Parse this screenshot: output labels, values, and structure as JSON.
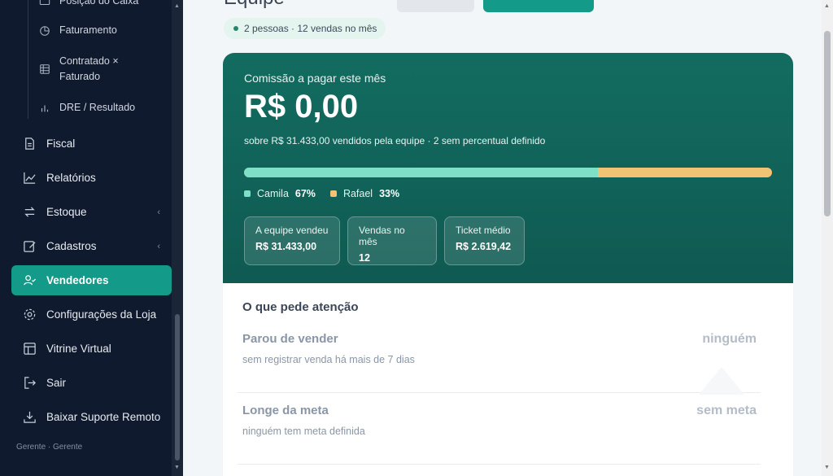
{
  "sidebar": {
    "sub_items": [
      {
        "label": "Posição do Caixa",
        "icon": "cash-icon"
      },
      {
        "label": "Faturamento",
        "icon": "pie-chart-icon"
      },
      {
        "label": "Contratado × Faturado",
        "icon": "table-icon"
      },
      {
        "label": "DRE / Resultado",
        "icon": "bar-chart-icon"
      }
    ],
    "items": [
      {
        "label": "Fiscal",
        "icon": "document-icon"
      },
      {
        "label": "Relatórios",
        "icon": "line-chart-icon"
      },
      {
        "label": "Estoque",
        "icon": "swap-icon",
        "chevron": "‹"
      },
      {
        "label": "Cadastros",
        "icon": "edit-icon",
        "chevron": "‹"
      },
      {
        "label": "Vendedores",
        "icon": "user-check-icon",
        "active": true
      },
      {
        "label": "Configurações da Loja",
        "icon": "gear-icon"
      },
      {
        "label": "Vitrine Virtual",
        "icon": "layout-icon"
      },
      {
        "label": "Sair",
        "icon": "logout-icon"
      },
      {
        "label": "Baixar Suporte Remoto",
        "icon": "download-icon"
      }
    ],
    "footer_role": "Gerente · Gerente"
  },
  "main": {
    "page_title": "Equipe",
    "summary_pill": "2 pessoas · 12 vendas no mês",
    "commission": {
      "label": "Comissão a pagar este mês",
      "amount": "R$ 0,00",
      "subtitle": "sobre R$ 31.433,00 vendidos pela equipe · 2 sem percentual definido",
      "split": [
        {
          "name": "Camila",
          "pct_label": "67%",
          "share": 0.67,
          "color": "#7fe0c8"
        },
        {
          "name": "Rafael",
          "pct_label": "33%",
          "share": 0.33,
          "color": "#f2c275"
        }
      ],
      "stats": [
        {
          "label": "A equipe vendeu",
          "value": "R$ 31.433,00"
        },
        {
          "label": "Vendas no mês",
          "value": "12"
        },
        {
          "label": "Ticket médio",
          "value": "R$ 2.619,42"
        }
      ]
    },
    "attention": {
      "title": "O que pede atenção",
      "rows": [
        {
          "heading": "Parou de vender",
          "desc": "sem registrar venda há mais de 7 dias",
          "value": "ninguém"
        },
        {
          "heading": "Longe da meta",
          "desc": "ninguém tem meta definida",
          "value": "sem meta"
        }
      ]
    }
  },
  "colors": {
    "sidebar_bg": "#0f1a2e",
    "accent": "#149a88",
    "card_top": "#136c60"
  }
}
